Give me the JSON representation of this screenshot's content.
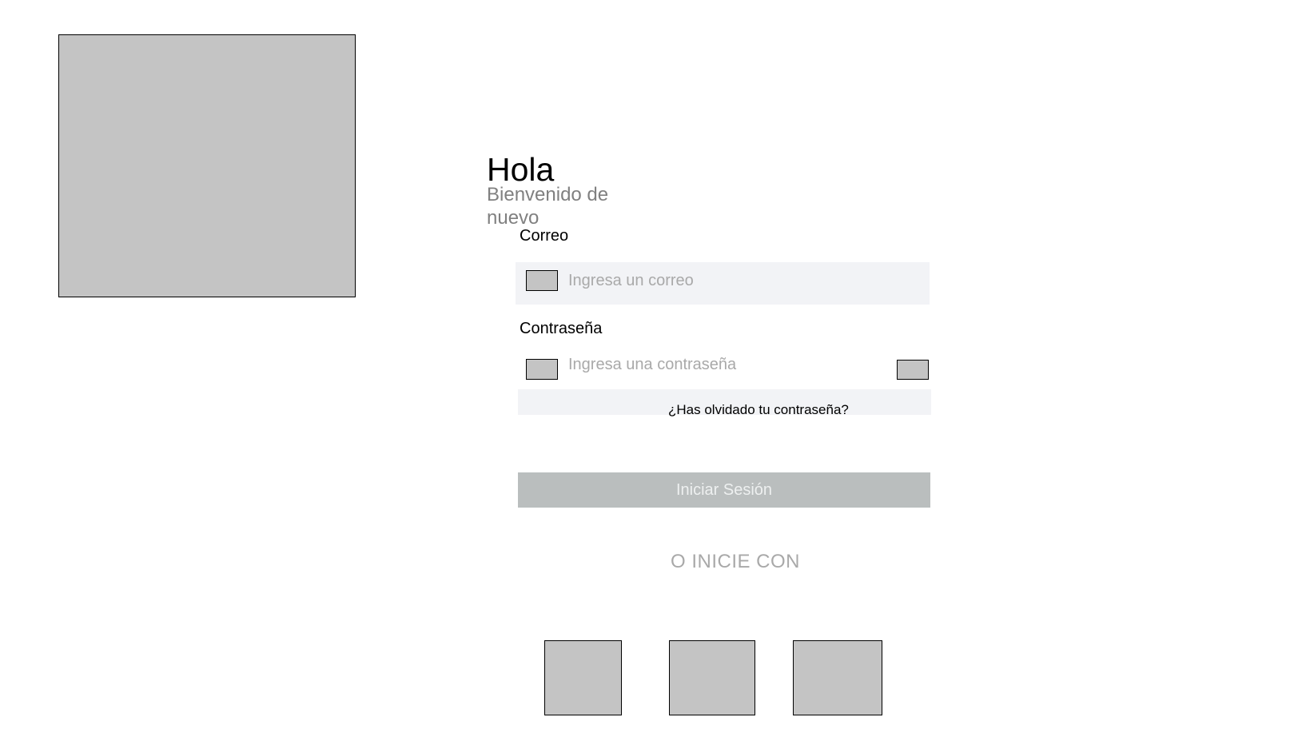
{
  "greeting": {
    "title": "Hola",
    "subtitle": "Bienvenido de nuevo"
  },
  "form": {
    "email": {
      "label": "Correo",
      "placeholder": "Ingresa un correo",
      "icon": "email-icon"
    },
    "password": {
      "label": "Contraseña",
      "placeholder": "Ingresa una contraseña",
      "icon": "lock-icon",
      "toggle_icon": "eye-icon"
    },
    "forgot_password": "¿Has olvidado tu contraseña?",
    "submit_label": "Iniciar Sesión"
  },
  "alt_login": {
    "divider": "O INICIE CON",
    "providers": [
      "social-provider-1",
      "social-provider-2",
      "social-provider-3"
    ]
  },
  "colors": {
    "placeholder_fill": "#c4c4c4",
    "input_background": "#f2f3f6",
    "button_background": "#babebe",
    "muted_text": "#a9a9a9",
    "subtitle_text": "#808080"
  }
}
